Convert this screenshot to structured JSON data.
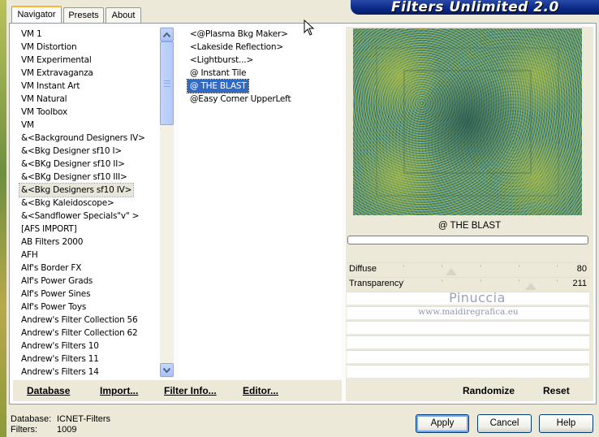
{
  "window": {
    "title": "Filters Unlimited 2.0"
  },
  "tabs": [
    {
      "label": "Navigator",
      "active": true
    },
    {
      "label": "Presets",
      "active": false
    },
    {
      "label": "About",
      "active": false
    }
  ],
  "categories": {
    "items": [
      "VM 1",
      "VM Distortion",
      "VM Experimental",
      "VM Extravaganza",
      "VM Instant Art",
      "VM Natural",
      "VM Toolbox",
      "VM",
      "&<Background Designers IV>",
      "&<Bkg Designer sf10 I>",
      "&<BKg Designer sf10 II>",
      "&<BKg Designer sf10 III>",
      "&<Bkg Designers sf10 IV>",
      "&<Bkg Kaleidoscope>",
      "&<Sandflower Specials\"v\" >",
      "[AFS IMPORT]",
      "AB Filters 2000",
      "AFH",
      "Alf's Border FX",
      "Alf's Power Grads",
      "Alf's Power Sines",
      "Alf's Power Toys",
      "Andrew's Filter Collection 56",
      "Andrew's Filter Collection 62",
      "Andrew's Filters 10",
      "Andrew's Filters 11",
      "Andrew's Filters 14"
    ],
    "current_index": 12
  },
  "filters": {
    "items": [
      "<@Plasma Bkg Maker>",
      "<Lakeside Reflection>",
      "<Lightburst...>",
      "@ Instant Tile",
      "@ THE BLAST",
      "@Easy Corner UpperLeft"
    ],
    "selected_index": 4
  },
  "preview": {
    "filter_name": "@ THE BLAST",
    "progress": 0
  },
  "parameters": [
    {
      "label": "Diffuse",
      "value": "80",
      "level": 0.31
    },
    {
      "label": "Transparency",
      "value": "211",
      "level": 0.83
    }
  ],
  "watermark": {
    "name": "Pinuccia",
    "url": "www.maidiregrafica.eu"
  },
  "commands": {
    "database": "Database",
    "import": "Import...",
    "filter_info": "Filter Info...",
    "editor": "Editor...",
    "randomize": "Randomize",
    "reset": "Reset"
  },
  "footer": {
    "database_label": "Database:",
    "database_value": "ICNET-Filters",
    "filters_label": "Filters:",
    "filters_value": "1009"
  },
  "buttons": {
    "apply": "Apply",
    "cancel": "Cancel",
    "help": "Help"
  },
  "icons": {
    "scroll_up": "chevron-up-icon",
    "scroll_down": "chevron-down-icon",
    "cursor": "mouse-pointer-icon"
  },
  "colors": {
    "selection": "#316ac5",
    "banner": "#0b2a8a",
    "tab_highlight": "#f9b537"
  }
}
